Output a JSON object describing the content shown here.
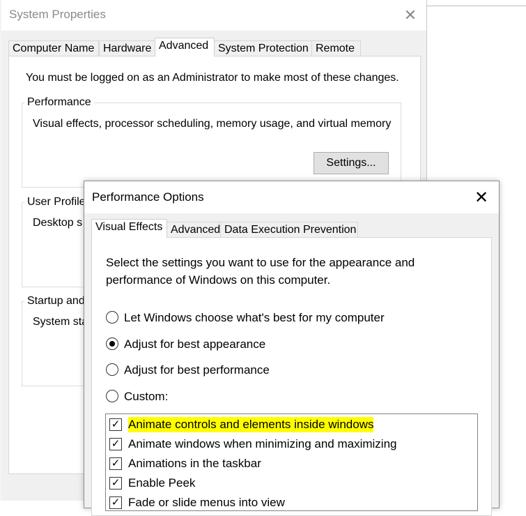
{
  "system_properties": {
    "title": "System Properties",
    "close_glyph": "✕",
    "tabs": [
      "Computer Name",
      "Hardware",
      "Advanced",
      "System Protection",
      "Remote"
    ],
    "active_tab": "Advanced",
    "admin_note": "You must be logged on as an Administrator to make most of these changes.",
    "performance": {
      "label": "Performance",
      "description": "Visual effects, processor scheduling, memory usage, and virtual memory",
      "settings_button": "Settings..."
    },
    "user_profiles": {
      "label": "User Profile",
      "description": "Desktop s"
    },
    "startup": {
      "label": "Startup and",
      "description": "System sta"
    }
  },
  "performance_options": {
    "title": "Performance Options",
    "close_glyph": "✕",
    "tabs": [
      "Visual Effects",
      "Advanced",
      "Data Execution Prevention"
    ],
    "active_tab": "Visual Effects",
    "description": "Select the settings you want to use for the appearance and performance of Windows on this computer.",
    "radio_options": [
      {
        "label": "Let Windows choose what's best for my computer",
        "checked": false
      },
      {
        "label": "Adjust for best appearance",
        "checked": true
      },
      {
        "label": "Adjust for best performance",
        "checked": false
      },
      {
        "label": "Custom:",
        "checked": false
      }
    ],
    "effects": [
      {
        "label": "Animate controls and elements inside windows",
        "checked": true,
        "highlighted": true
      },
      {
        "label": "Animate windows when minimizing and maximizing",
        "checked": true,
        "highlighted": false
      },
      {
        "label": "Animations in the taskbar",
        "checked": true,
        "highlighted": false
      },
      {
        "label": "Enable Peek",
        "checked": true,
        "highlighted": false
      },
      {
        "label": "Fade or slide menus into view",
        "checked": true,
        "highlighted": false
      }
    ],
    "checkmark_glyph": "✓",
    "highlight_color": "#ffff00"
  }
}
